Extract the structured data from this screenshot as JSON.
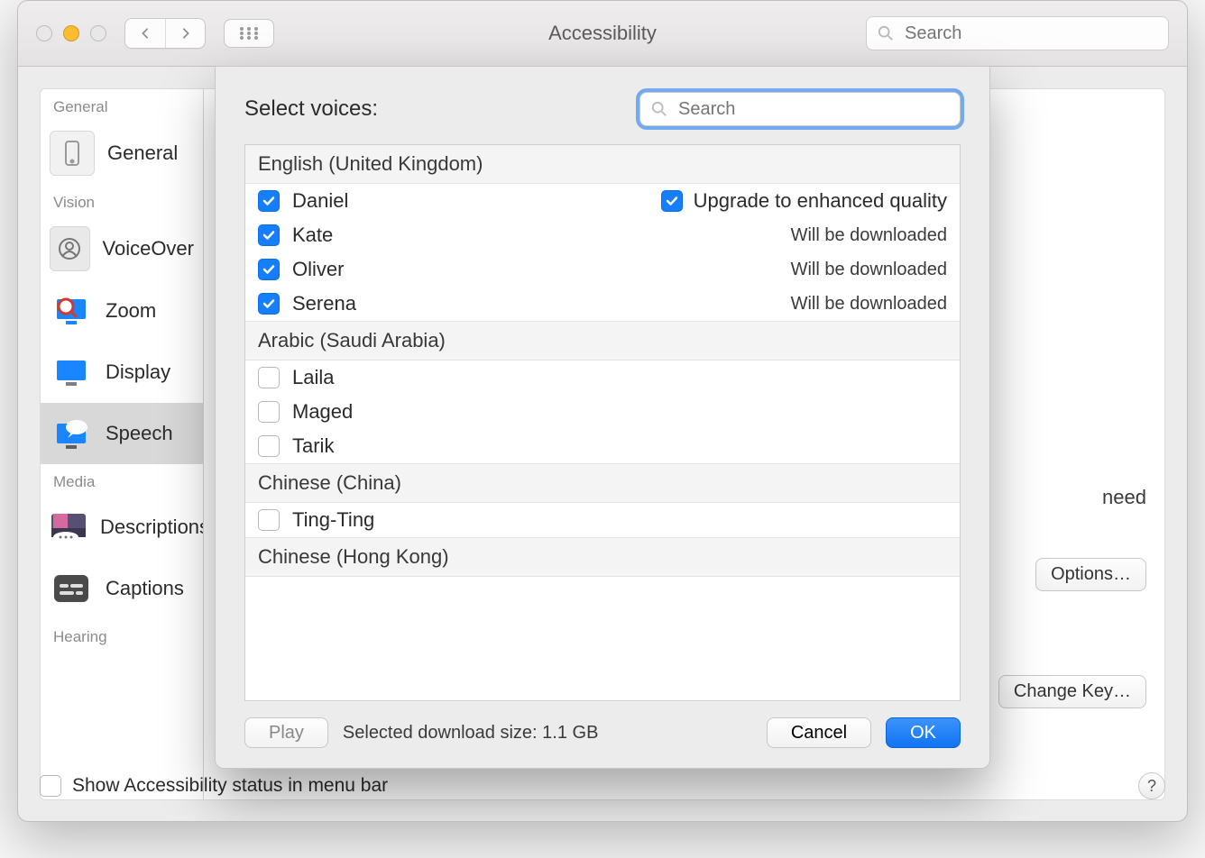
{
  "window": {
    "title": "Accessibility",
    "search_placeholder": "Search"
  },
  "sidebar": {
    "sections": [
      {
        "label": "General",
        "items": [
          {
            "id": "general",
            "label": "General"
          }
        ]
      },
      {
        "label": "Vision",
        "items": [
          {
            "id": "voiceover",
            "label": "VoiceOver"
          },
          {
            "id": "zoom",
            "label": "Zoom"
          },
          {
            "id": "display",
            "label": "Display"
          },
          {
            "id": "speech",
            "label": "Speech",
            "selected": true
          }
        ]
      },
      {
        "label": "Media",
        "items": [
          {
            "id": "descriptions",
            "label": "Descriptions"
          },
          {
            "id": "captions",
            "label": "Captions"
          }
        ]
      },
      {
        "label": "Hearing",
        "items": []
      }
    ]
  },
  "mainpane": {
    "need_text": "need",
    "options_btn": "Options…",
    "change_key_btn": "Change Key…"
  },
  "bottom": {
    "show_status_label": "Show Accessibility status in menu bar"
  },
  "sheet": {
    "title": "Select voices:",
    "search_placeholder": "Search",
    "download_size_label": "Selected download size: 1.1 GB",
    "play_btn": "Play",
    "cancel_btn": "Cancel",
    "ok_btn": "OK",
    "upgrade_label": "Upgrade to enhanced quality",
    "will_download": "Will be downloaded",
    "groups": [
      {
        "label": "English (United Kingdom)",
        "voices": [
          {
            "name": "Daniel",
            "checked": true,
            "upgrade": true
          },
          {
            "name": "Kate",
            "checked": true,
            "status": "will_download"
          },
          {
            "name": "Oliver",
            "checked": true,
            "status": "will_download"
          },
          {
            "name": "Serena",
            "checked": true,
            "status": "will_download"
          }
        ]
      },
      {
        "label": "Arabic (Saudi Arabia)",
        "voices": [
          {
            "name": "Laila",
            "checked": false
          },
          {
            "name": "Maged",
            "checked": false
          },
          {
            "name": "Tarik",
            "checked": false
          }
        ]
      },
      {
        "label": "Chinese (China)",
        "voices": [
          {
            "name": "Ting-Ting",
            "checked": false
          }
        ]
      },
      {
        "label": "Chinese (Hong Kong)",
        "voices": []
      }
    ]
  }
}
